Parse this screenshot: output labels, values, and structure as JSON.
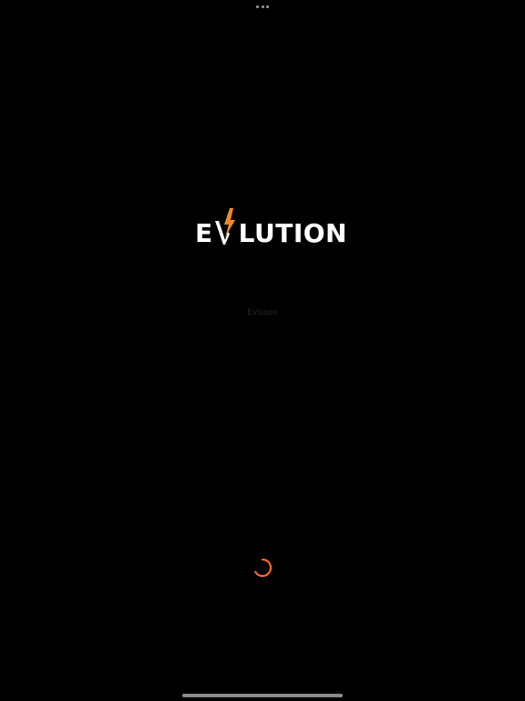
{
  "logo": {
    "prefix": "E",
    "suffix": "LUTION",
    "accent_color": "#f08a24",
    "text_color": "#ffffff"
  },
  "app_label": "Evlution",
  "icons": {
    "multitask": "ellipsis-icon",
    "bolt": "lightning-bolt-icon",
    "spinner": "loading-spinner-icon"
  },
  "colors": {
    "background": "#000000",
    "spinner": "#f26b2a",
    "home_indicator": "#8a8a8a"
  }
}
